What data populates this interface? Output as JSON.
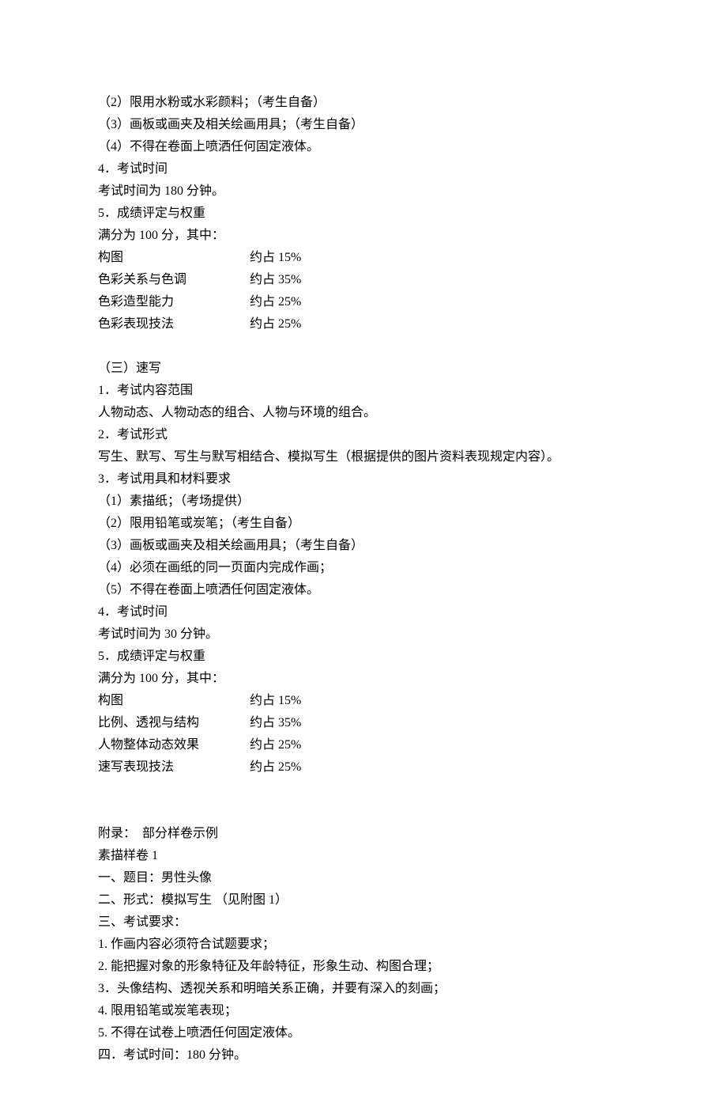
{
  "color_section": {
    "mat_2": "（2）限用水粉或水彩颜料；（考生自备）",
    "mat_3": "（3）画板或画夹及相关绘画用具；（考生自备）",
    "mat_4": "（4）不得在卷面上喷洒任何固定液体。",
    "item4_title": "4．考试时间",
    "item4_body": "考试时间为 180 分钟。",
    "item5_title": "5．成绩评定与权重",
    "item5_intro": "满分为 100 分，其中：",
    "weights": [
      {
        "label": "构图",
        "value": "约占 15%"
      },
      {
        "label": "色彩关系与色调",
        "value": "约占 35%"
      },
      {
        "label": "色彩造型能力",
        "value": "约占 25%"
      },
      {
        "label": "色彩表现技法",
        "value": "约占 25%"
      }
    ]
  },
  "sketch_section": {
    "heading": "（三）速写",
    "item1_title": "1．考试内容范围",
    "item1_body": "人物动态、人物动态的组合、人物与环境的组合。",
    "item2_title": "2．考试形式",
    "item2_body": "写生、默写、写生与默写相结合、模拟写生（根据提供的图片资料表现规定内容）。",
    "item3_title": "3．考试用具和材料要求",
    "mat_1": "（1）素描纸；（考场提供）",
    "mat_2": "（2）限用铅笔或炭笔；（考生自备）",
    "mat_3": "（3）画板或画夹及相关绘画用具；（考生自备）",
    "mat_4": "（4）必须在画纸的同一页面内完成作画；",
    "mat_5": "（5）不得在卷面上喷洒任何固定液体。",
    "item4_title": "4．考试时间",
    "item4_body": "考试时间为 30 分钟。",
    "item5_title": "5．成绩评定与权重",
    "item5_intro": "满分为 100 分，其中：",
    "weights": [
      {
        "label": "构图",
        "value": "约占 15%"
      },
      {
        "label": "比例、透视与结构",
        "value": "约占 35%"
      },
      {
        "label": "人物整体动态效果",
        "value": "约占 25%"
      },
      {
        "label": "速写表现技法",
        "value": "约占 25%"
      }
    ]
  },
  "appendix": {
    "heading": "附录：  部分样卷示例",
    "sample_title": "素描样卷 1",
    "line1": "一、题目：男性头像",
    "line2": "二、形式：模拟写生 （见附图 1）",
    "line3": "三、考试要求：",
    "req1": "1. 作画内容必须符合试题要求；",
    "req2": "2. 能把握对象的形象特征及年龄特征，形象生动、构图合理；",
    "req3": "3．头像结构、透视关系和明暗关系正确，并要有深入的刻画；",
    "req4": "4. 限用铅笔或炭笔表现；",
    "req5": "5. 不得在试卷上喷洒任何固定液体。",
    "line4": "四．考试时间：180 分钟。"
  }
}
